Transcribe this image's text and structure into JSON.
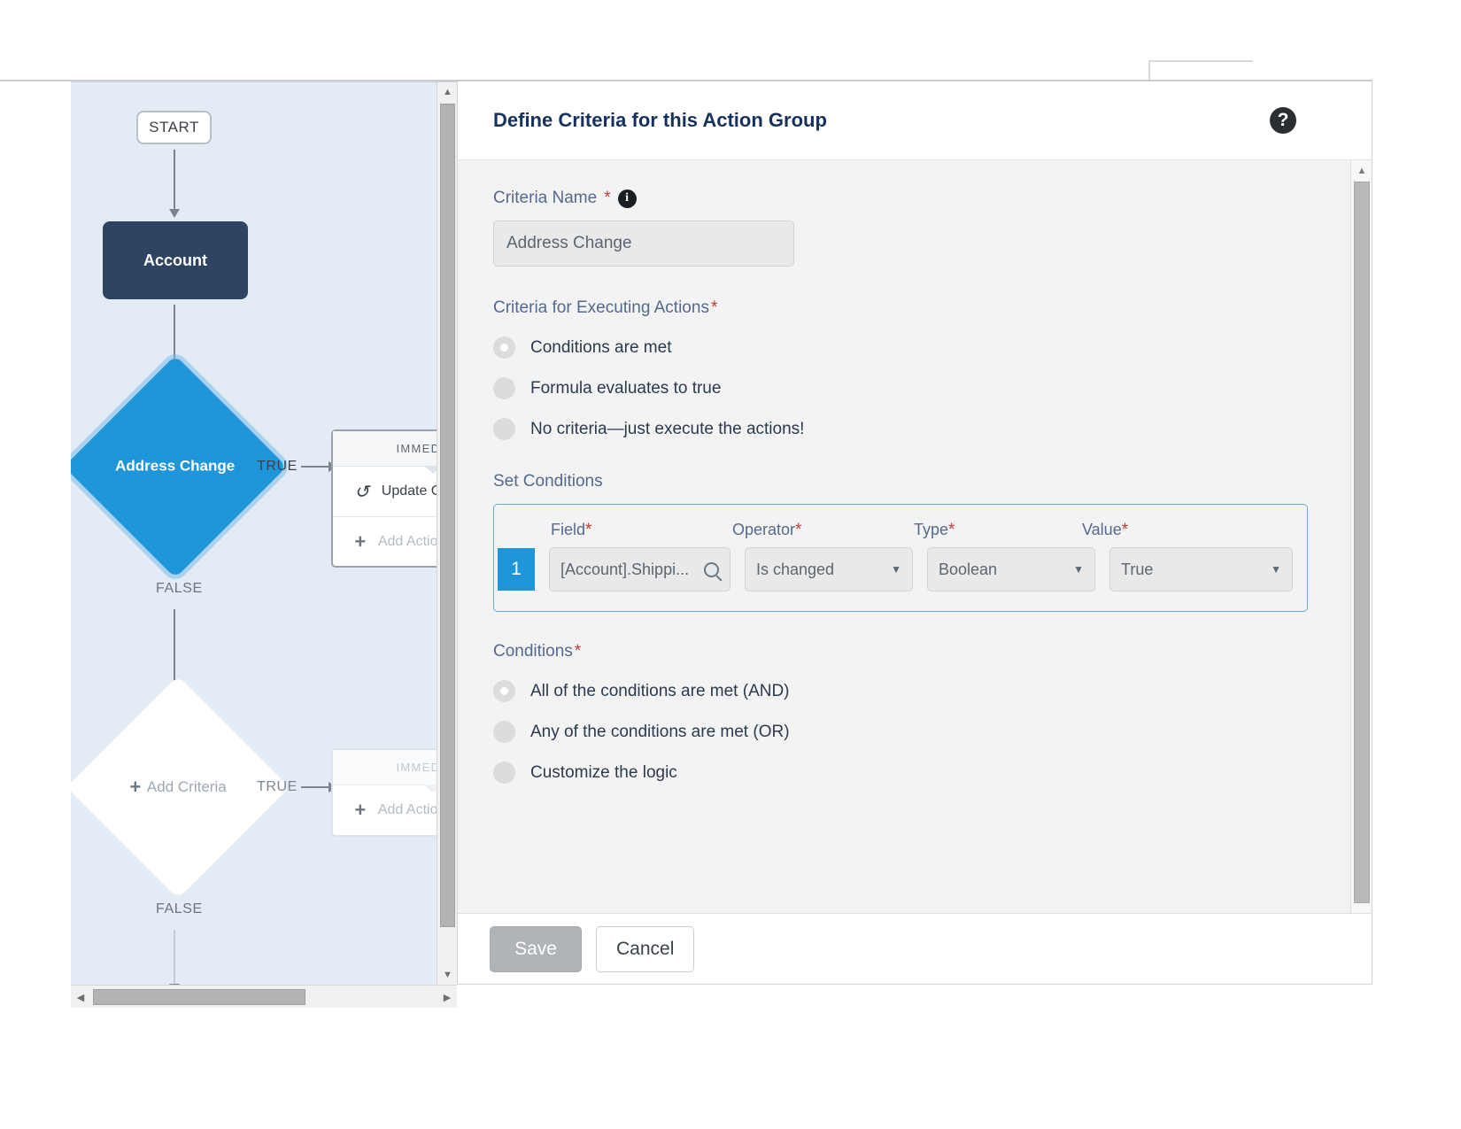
{
  "flowchart": {
    "start_label": "START",
    "object_node": "Account",
    "criteria_node_active": "Address Change",
    "criteria_node_empty": "Add Criteria",
    "true_label_1": "TRUE",
    "true_label_2": "TRUE",
    "false_label_1": "FALSE",
    "false_label_2": "FALSE",
    "action_group_1": {
      "header": "IMMEDIATE",
      "action": "Update Co",
      "add_action": "Add Actio"
    },
    "action_group_2": {
      "header": "IMMEDIATE",
      "add_action": "Add Actio"
    }
  },
  "dialog": {
    "title": "Define Criteria for this Action Group",
    "help_icon": "question-mark-icon",
    "criteria_name": {
      "label": "Criteria Name",
      "required": "*",
      "info_icon": "info-icon",
      "value": "Address Change"
    },
    "criteria_for_executing": {
      "label": "Criteria for Executing Actions",
      "required": "*",
      "options": [
        {
          "label": "Conditions are met",
          "selected": true
        },
        {
          "label": "Formula evaluates to true",
          "selected": false
        },
        {
          "label": "No criteria—just execute the actions!",
          "selected": false
        }
      ]
    },
    "set_conditions": {
      "label": "Set Conditions",
      "columns": [
        {
          "label": "Field",
          "required": "*"
        },
        {
          "label": "Operator",
          "required": "*"
        },
        {
          "label": "Type",
          "required": "*"
        },
        {
          "label": "Value",
          "required": "*"
        }
      ],
      "rows": [
        {
          "number": "1",
          "field": "[Account].Shippi...",
          "field_icon": "search-icon",
          "operator": "Is changed",
          "type": "Boolean",
          "value": "True"
        }
      ]
    },
    "conditions": {
      "label": "Conditions",
      "required": "*",
      "options": [
        {
          "label": "All of the conditions are met (AND)",
          "selected": true
        },
        {
          "label": "Any of the conditions are met (OR)",
          "selected": false
        },
        {
          "label": "Customize the logic",
          "selected": false
        }
      ]
    },
    "footer": {
      "save_label": "Save",
      "cancel_label": "Cancel"
    }
  },
  "scrollbars": {
    "up_arrow": "▲",
    "down_arrow": "▼",
    "left_arrow": "◀",
    "right_arrow": "▶"
  },
  "colors": {
    "accent_blue": "#1f96d9",
    "object_navy": "#2e4460",
    "canvas_bg": "#e3ecf5",
    "label_blue": "#54698d",
    "required_red": "#c23934"
  }
}
